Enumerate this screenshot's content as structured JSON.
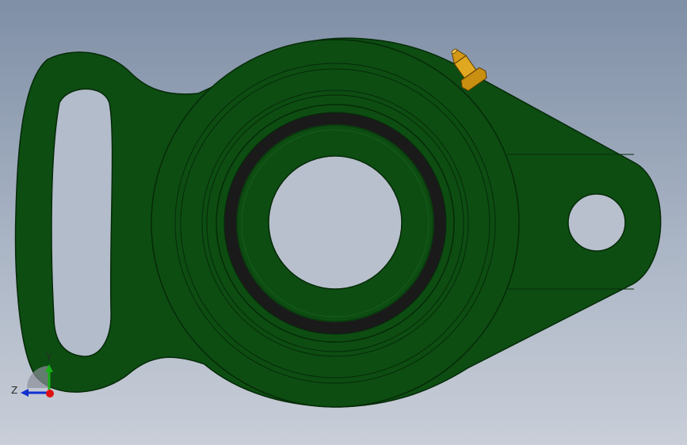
{
  "viewport": {
    "part_color": "#0d4d12",
    "bore_color": "#1a1a1a",
    "fitting_color": "#d9a21a"
  },
  "model": {
    "parts": [
      {
        "name": "bearing-housing-flange",
        "color": "#0d4d12"
      },
      {
        "name": "grease-fitting",
        "color": "#d9a21a"
      },
      {
        "name": "bearing-insert",
        "color": "#0d4d12"
      }
    ]
  },
  "triad": {
    "y_label": "Y",
    "z_label": "Z",
    "x_color": "#e01010",
    "y_color": "#18b018",
    "z_color": "#1030d0"
  }
}
